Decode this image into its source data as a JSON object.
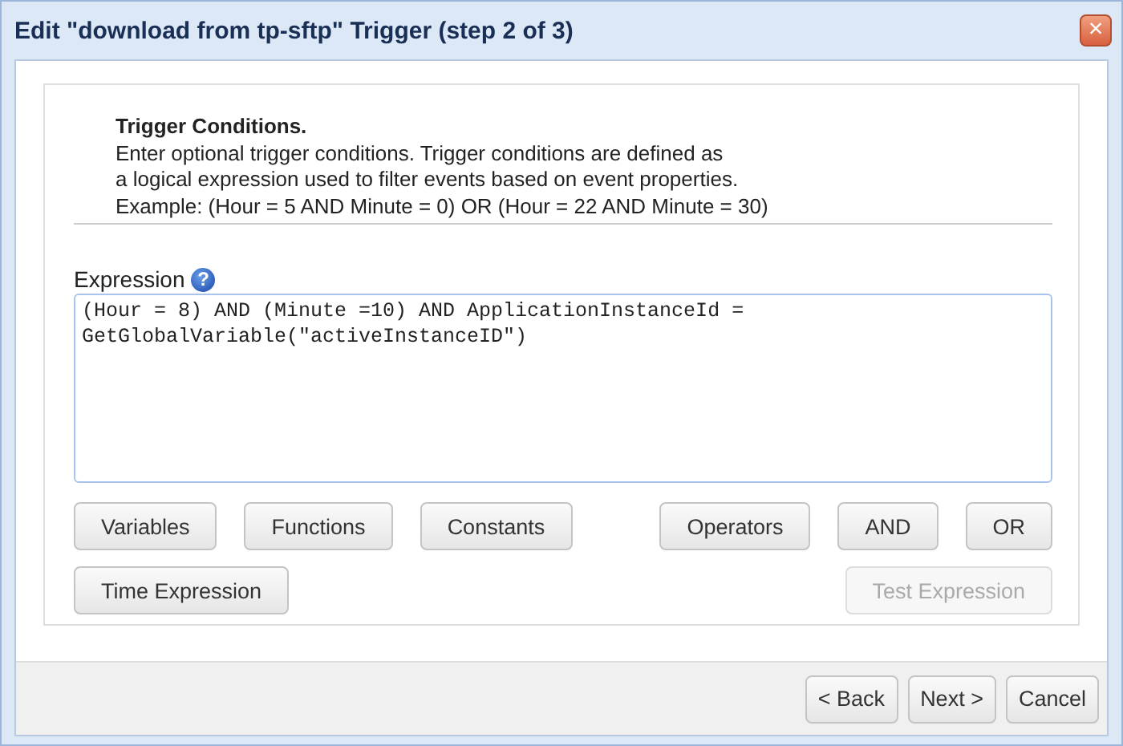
{
  "window": {
    "title": "Edit \"download from tp-sftp\" Trigger (step 2 of 3)",
    "close": "×"
  },
  "intro": {
    "heading": "Trigger Conditions.",
    "lines": [
      "Enter optional trigger conditions. Trigger conditions are defined as",
      "a logical expression used to filter events based on event properties.",
      "Example: (Hour = 5 AND Minute = 0) OR (Hour = 22 AND Minute = 30)"
    ]
  },
  "expression": {
    "label": "Expression",
    "help": "?",
    "value": "(Hour = 8) AND (Minute =10) AND ApplicationInstanceId =\nGetGlobalVariable(\"activeInstanceID\")"
  },
  "button_rows": [
    {
      "left": [
        {
          "label": "Variables",
          "disabled": false
        },
        {
          "label": "Functions",
          "disabled": false
        },
        {
          "label": "Constants",
          "disabled": false
        }
      ],
      "right": [
        {
          "label": "Operators",
          "disabled": false
        },
        {
          "label": "AND",
          "disabled": false
        },
        {
          "label": "OR",
          "disabled": false
        }
      ]
    },
    {
      "left": [
        {
          "label": "Time Expression",
          "disabled": false
        }
      ],
      "right": [
        {
          "label": "Test Expression",
          "disabled": true
        }
      ]
    }
  ],
  "footer_buttons": [
    {
      "label": "< Back",
      "disabled": false
    },
    {
      "label": "Next >",
      "disabled": false
    },
    {
      "label": "Cancel",
      "disabled": false
    }
  ]
}
